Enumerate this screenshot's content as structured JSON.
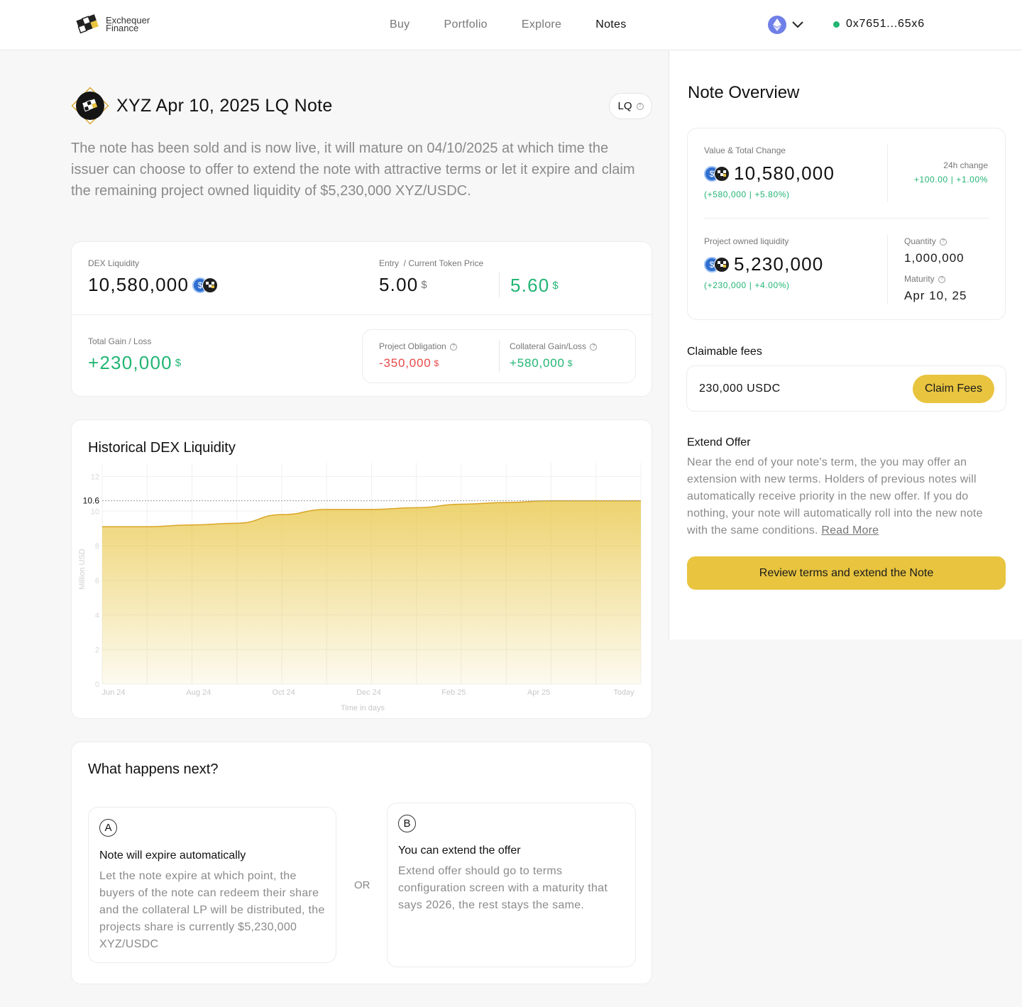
{
  "header": {
    "logo_line1": "Exchequer",
    "logo_line2": "Finance",
    "nav": [
      "Buy",
      "Portfolio",
      "Explore",
      "Notes"
    ],
    "active_nav": "Notes",
    "wallet_address": "0x7651...65x6",
    "network_icon": "ethereum-icon"
  },
  "note": {
    "title": "XYZ Apr 10, 2025 LQ Note",
    "badge": "LQ",
    "description": "The note has been sold and is now live, it will mature on 04/10/2025 at which time the issuer can choose to offer to extend the note with attractive terms or let it expire and claim the remaining project owned liquidity of $5,230,000 XYZ/USDC."
  },
  "stats": {
    "dex_label": "DEX Liquidity",
    "dex_value": "10,580,000",
    "price_label": "Entry  / Current Token Price",
    "entry_price": "5.00",
    "current_price": "5.60",
    "currency": "$",
    "gain_label": "Total Gain / Loss",
    "gain_value": "+230,000",
    "obligation_label": "Project Obligation",
    "obligation_value": "-350,000",
    "collateral_label": "Collateral Gain/Loss",
    "collateral_value": "+580,000"
  },
  "chart_data": {
    "type": "area",
    "title": "Historical DEX Liquidity",
    "xlabel": "Time in days",
    "ylabel": "Million USD",
    "x_ticks": [
      "Jun 24",
      "Aug 24",
      "Oct 24",
      "Dec 24",
      "Feb 25",
      "Apr 25",
      "Today"
    ],
    "y_ticks": [
      "12",
      "10",
      "8",
      "6",
      "4",
      "2",
      "0"
    ],
    "ylim": [
      0,
      12.8
    ],
    "reference_line": {
      "value": 10.6,
      "label": "10.6"
    },
    "series": [
      {
        "values": [
          9.1,
          9.1,
          9.2,
          9.3,
          9.8,
          10.1,
          10.1,
          10.2,
          10.4,
          10.5,
          10.6,
          10.6,
          10.6
        ]
      }
    ],
    "color": "#e8c43f"
  },
  "overview": {
    "title": "Note Overview",
    "value_label": "Value & Total Change",
    "value": "10,580,000",
    "value_change": "(+580,000 | +5.80%)",
    "change24_label": "24h change",
    "change24_value": "+100.00 | +1.00%",
    "pol_label": "Project owned liquidity",
    "pol_value": "5,230,000",
    "pol_change": "(+230,000 | +4.00%)",
    "quantity_label": "Quantity",
    "quantity_value": "1,000,000",
    "maturity_label": "Maturity",
    "maturity_value": "Apr 10, 25"
  },
  "claim": {
    "label": "Claimable fees",
    "value": "230,000 USDC",
    "button": "Claim Fees"
  },
  "extend": {
    "title": "Extend Offer",
    "text": "Near the end of your note's term, the you may offer an extension with new terms. Holders of previous notes will automatically receive priority in the new offer. If you do nothing, your note will automatically roll into the new note with the same conditions.",
    "link": "Read More",
    "button": "Review terms and extend the Note"
  },
  "next": {
    "title": "What happens next?",
    "or": "OR",
    "option_a": {
      "letter": "A",
      "title": "Note will expire automatically",
      "text": "Let the note expire at which point, the buyers of the note can redeem their share and the collateral LP will be distributed, the projects share is currently $5,230,000 XYZ/USDC"
    },
    "option_b": {
      "letter": "B",
      "title": "You can extend the offer",
      "text": "Extend offer should go to terms configuration screen with a maturity that says 2026, the rest stays the same."
    }
  }
}
